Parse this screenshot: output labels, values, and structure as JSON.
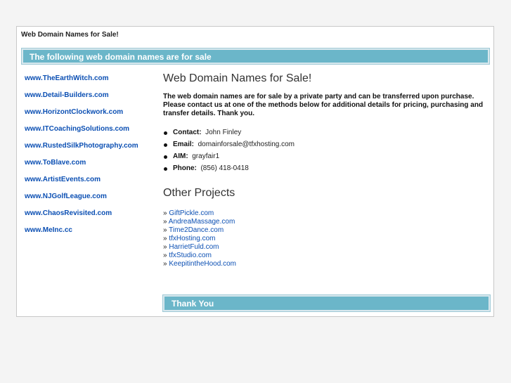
{
  "page": {
    "site_title": "Web Domain Names for Sale!"
  },
  "banner": {
    "text": "The following web domain names are for sale"
  },
  "domains": [
    "www.TheEarthWitch.com",
    "www.Detail-Builders.com",
    "www.HorizontClockwork.com",
    "www.ITCoachingSolutions.com",
    "www.RustedSilkPhotography.com",
    "www.ToBlave.com",
    "www.ArtistEvents.com",
    "www.NJGolfLeague.com",
    "www.ChaosRevisited.com",
    "www.MeInc.cc"
  ],
  "main": {
    "heading": "Web Domain Names for Sale!",
    "intro": "The web domain names are for sale by a private party and can be transferred upon purchase. Please contact us at one of the methods below for additional details for pricing, purchasing and transfer details.   Thank you.",
    "contacts": [
      {
        "label": "Contact:",
        "value": "John Finley"
      },
      {
        "label": "Email:",
        "value": "domainforsale@tfxhosting.com"
      },
      {
        "label": "AIM:",
        "value": "grayfair1"
      },
      {
        "label": "Phone:",
        "value": "(856) 418-0418"
      }
    ],
    "projects_heading": "Other Projects",
    "projects_prefix": "» ",
    "projects": [
      "GiftPickle.com",
      "AndreaMassage.com",
      "Time2Dance.com",
      "tfxHosting.com",
      "HarrietFuld.com",
      "tfxStudio.com",
      "KeepitintheHood.com"
    ]
  },
  "footer": {
    "text": "Thank You"
  },
  "colors": {
    "banner": "#6bb6c9",
    "link": "#0b4fb3"
  }
}
